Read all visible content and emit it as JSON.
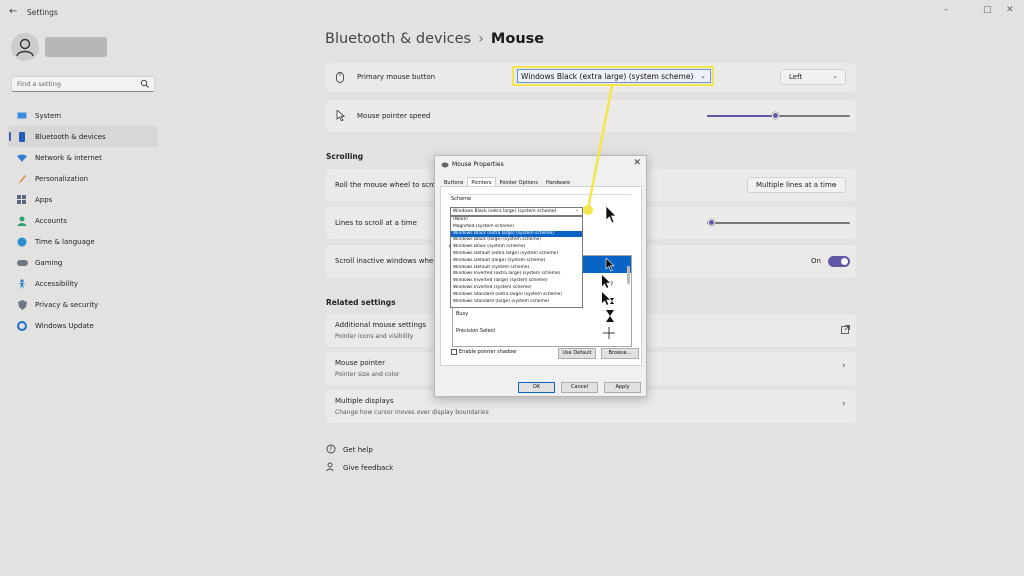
{
  "window": {
    "title": "Settings"
  },
  "header": {
    "breadcrumb_parent": "Bluetooth & devices",
    "breadcrumb_sep": "›",
    "breadcrumb_current": "Mouse"
  },
  "search": {
    "placeholder": "Find a setting"
  },
  "sidebar": {
    "items": [
      {
        "label": "System",
        "icon": "system-icon"
      },
      {
        "label": "Bluetooth & devices",
        "icon": "bluetooth-icon",
        "active": true
      },
      {
        "label": "Network & internet",
        "icon": "wifi-icon"
      },
      {
        "label": "Personalization",
        "icon": "brush-icon"
      },
      {
        "label": "Apps",
        "icon": "apps-icon"
      },
      {
        "label": "Accounts",
        "icon": "accounts-icon"
      },
      {
        "label": "Time & language",
        "icon": "globe-icon"
      },
      {
        "label": "Gaming",
        "icon": "gamepad-icon"
      },
      {
        "label": "Accessibility",
        "icon": "accessibility-icon"
      },
      {
        "label": "Privacy & security",
        "icon": "shield-icon"
      },
      {
        "label": "Windows Update",
        "icon": "update-icon"
      }
    ]
  },
  "main": {
    "primary_button": {
      "label": "Primary mouse button",
      "value": "Left"
    },
    "pointer_speed": {
      "label": "Mouse pointer speed",
      "level": 0.48
    },
    "scrolling": {
      "heading": "Scrolling",
      "roll_label": "Roll the mouse wheel to scroll",
      "roll_value": "Multiple lines at a time",
      "lines_label": "Lines to scroll at a time",
      "lines_level": 0.03,
      "inactive_label": "Scroll inactive windows when I",
      "inactive_state": "On"
    },
    "related": {
      "heading": "Related settings",
      "items": [
        {
          "label": "Additional mouse settings",
          "sub": "Pointer icons and visibility"
        },
        {
          "label": "Mouse pointer",
          "sub": "Pointer size and color"
        },
        {
          "label": "Multiple displays",
          "sub": "Change how cursor moves over display boundaries"
        }
      ]
    },
    "help": {
      "get_help": "Get help",
      "feedback": "Give feedback"
    }
  },
  "callout": {
    "text": "Windows Black (extra large) (system scheme)",
    "color": "#f4e64a"
  },
  "dialog": {
    "title": "Mouse Properties",
    "tabs": [
      "Buttons",
      "Pointers",
      "Pointer Options",
      "Hardware"
    ],
    "active_tab": "Pointers",
    "scheme_label": "Scheme",
    "scheme_value": "Windows Black (extra large) (system scheme)",
    "options": [
      "(None)",
      "Magnified (system scheme)",
      "Windows Black (extra large) (system scheme)",
      "Windows Black (large) (system scheme)",
      "Windows Black (system scheme)",
      "Windows Default (extra large) (system scheme)",
      "Windows Default (large) (system scheme)",
      "Windows Default (system scheme)",
      "Windows Inverted (extra large) (system scheme)",
      "Windows Inverted (large) (system scheme)",
      "Windows Inverted (system scheme)",
      "Windows Standard (extra large) (system scheme)",
      "Windows Standard (large) (system scheme)"
    ],
    "selected_option_index": 2,
    "customize_partial": "C",
    "customize_rows": [
      "",
      "",
      "",
      "Busy",
      "Precision Select"
    ],
    "shadow_label": "Enable pointer shadow",
    "use_default": "Use Default",
    "browse": "Browse...",
    "ok": "OK",
    "cancel": "Cancel",
    "apply": "Apply"
  },
  "colors": {
    "accent": "#5e58a5",
    "highlight": "#0a64c6",
    "callout": "#f4e64a"
  }
}
